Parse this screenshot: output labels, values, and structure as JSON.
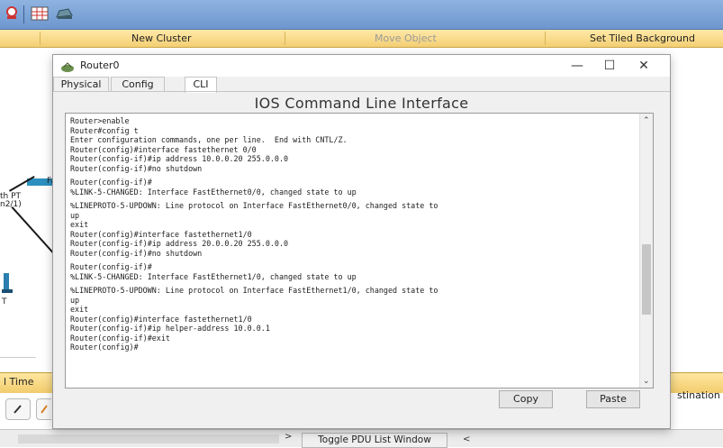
{
  "toolbar": {
    "icons": [
      "search-icon",
      "grid-icon",
      "cloud-icon"
    ]
  },
  "labelbar": {
    "new_cluster": "New Cluster",
    "move_object": "Move Object",
    "set_tiled_background": "Set Tiled Background"
  },
  "workspace": {
    "labels": [
      "Fa",
      "th PT",
      "n2/1)",
      "T"
    ]
  },
  "window": {
    "title": "Router0",
    "tabs": [
      "Physical",
      "Config",
      "CLI"
    ],
    "active_tab": "CLI",
    "heading": "IOS Command Line Interface",
    "cli_lines": [
      "Router>enable",
      "Router#config t",
      "Enter configuration commands, one per line.  End with CNTL/Z.",
      "Router(config)#interface fastethernet 0/0",
      "Router(config-if)#ip address 10.0.0.20 255.0.0.0",
      "Router(config-if)#no shutdown",
      "",
      "Router(config-if)#",
      "%LINK-5-CHANGED: Interface FastEthernet0/0, changed state to up",
      "",
      "%LINEPROTO-5-UPDOWN: Line protocol on Interface FastEthernet0/0, changed state to",
      "up",
      "exit",
      "Router(config)#interface fastethernet1/0",
      "Router(config-if)#ip address 20.0.0.20 255.0.0.0",
      "Router(config-if)#no shutdown",
      "",
      "Router(config-if)#",
      "%LINK-5-CHANGED: Interface FastEthernet1/0, changed state to up",
      "",
      "%LINEPROTO-5-UPDOWN: Line protocol on Interface FastEthernet1/0, changed state to",
      "up",
      "exit",
      "Router(config)#interface fastethernet1/0",
      "Router(config-if)#ip helper-address 10.0.0.1",
      "Router(config-if)#exit",
      "Router(config)#"
    ],
    "copy_label": "Copy",
    "paste_label": "Paste"
  },
  "bottom": {
    "time_label": "l Time",
    "destination_label": "stination",
    "toggle_pdu_label": "Toggle PDU List Window"
  }
}
